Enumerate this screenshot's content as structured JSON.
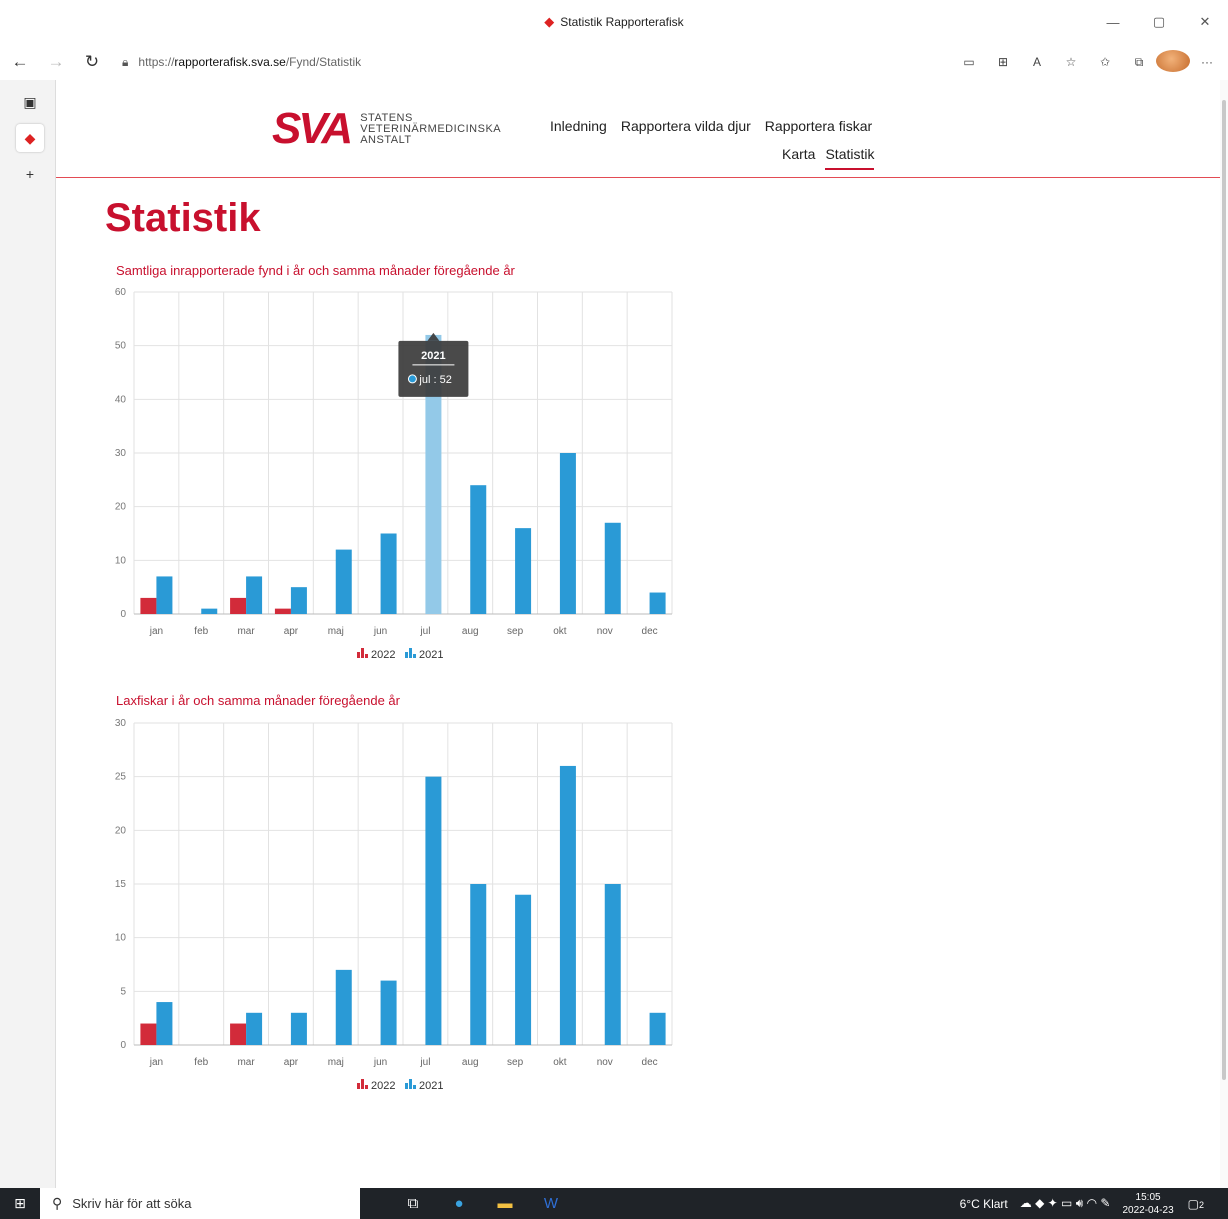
{
  "window": {
    "title": "Statistik Rapporterafisk"
  },
  "browser": {
    "url_prefix": "https://",
    "url_domain": "rapporterafisk.sva.se",
    "url_path": "/Fynd/Statistik"
  },
  "site": {
    "logo_text": "SVA",
    "logo_sub": [
      "STATENS",
      "VETERINÄRMEDICINSKA",
      "ANSTALT"
    ],
    "menu": [
      "Inledning",
      "Rapportera vilda djur",
      "Rapportera fiskar"
    ],
    "submenu": [
      "Karta",
      "Statistik"
    ],
    "active_submenu": "Statistik"
  },
  "page": {
    "title": "Statistik"
  },
  "colors": {
    "accent": "#c8102e",
    "series2022": "#d22b3a",
    "series2021": "#2a9ad6",
    "highlight": "#93c9e8"
  },
  "chart_data": [
    {
      "type": "bar",
      "title": "Samtliga inrapporterade fynd i år och samma månader föregående år",
      "categories": [
        "jan",
        "feb",
        "mar",
        "apr",
        "maj",
        "jun",
        "jul",
        "aug",
        "sep",
        "okt",
        "nov",
        "dec"
      ],
      "series": [
        {
          "name": "2022",
          "values": [
            3,
            0,
            3,
            1,
            0,
            0,
            0,
            0,
            0,
            0,
            0,
            0
          ]
        },
        {
          "name": "2021",
          "values": [
            7,
            1,
            7,
            5,
            12,
            15,
            52,
            24,
            16,
            30,
            17,
            4
          ]
        }
      ],
      "yticks": [
        0,
        10,
        20,
        30,
        40,
        50,
        60
      ],
      "ylim": [
        0,
        60
      ],
      "grid": true,
      "legend": "bottom-center",
      "tooltip": {
        "title": "2021",
        "label": "jul",
        "value": "52",
        "text": "jul : 52"
      }
    },
    {
      "type": "bar",
      "title": "Laxfiskar i år och samma månader föregående år",
      "categories": [
        "jan",
        "feb",
        "mar",
        "apr",
        "maj",
        "jun",
        "jul",
        "aug",
        "sep",
        "okt",
        "nov",
        "dec"
      ],
      "series": [
        {
          "name": "2022",
          "values": [
            2,
            0,
            2,
            0,
            0,
            0,
            0,
            0,
            0,
            0,
            0,
            0
          ]
        },
        {
          "name": "2021",
          "values": [
            4,
            0,
            3,
            3,
            7,
            6,
            25,
            15,
            14,
            26,
            15,
            3
          ]
        }
      ],
      "yticks": [
        0,
        5,
        10,
        15,
        20,
        25,
        30
      ],
      "ylim": [
        0,
        30
      ],
      "grid": true,
      "legend": "bottom-center"
    }
  ],
  "taskbar": {
    "search_placeholder": "Skriv här för att söka",
    "weather": "6°C Klart",
    "time": "15:05",
    "date": "2022-04-23",
    "notifications": "2"
  }
}
